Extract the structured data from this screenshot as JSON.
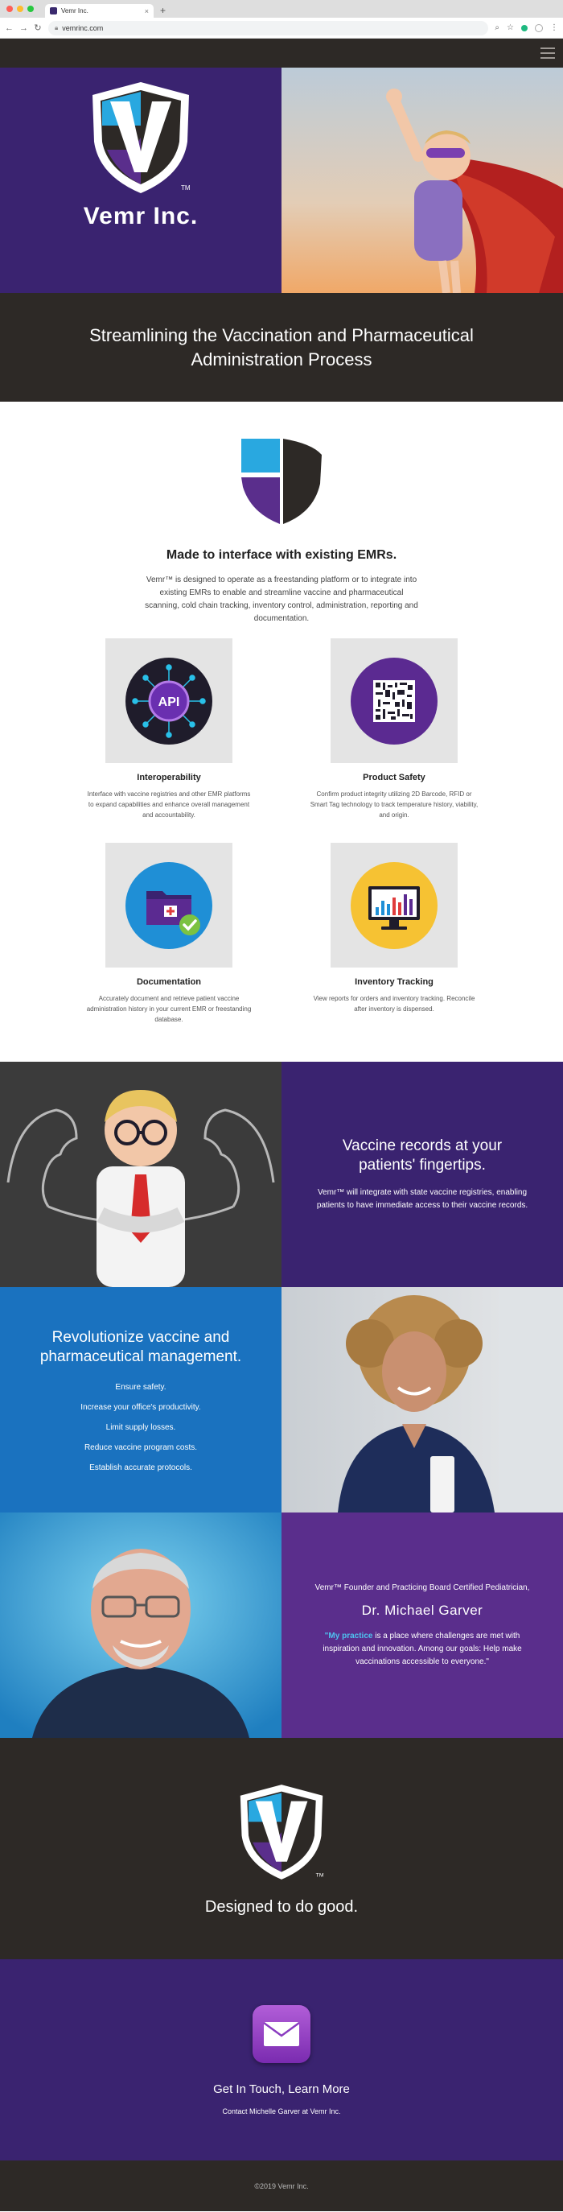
{
  "browser": {
    "tab_title": "Vemr Inc.",
    "tab_close": "×",
    "new_tab": "+",
    "url": "vemrinc.com",
    "nav": {
      "back": "←",
      "forward": "→",
      "reload": "↻"
    },
    "actions": {
      "search": "⌕",
      "star": "☆",
      "menu": "⋮"
    }
  },
  "hero": {
    "brand": "Vemr Inc.",
    "trademark": "TM"
  },
  "banner": {
    "title": "Streamlining the Vaccination and Pharmaceutical Administration Process"
  },
  "emr": {
    "heading": "Made to interface with existing EMRs.",
    "lead": "Vemr™ is designed to operate as a freestanding platform or to integrate into existing EMRs to enable and streamline vaccine and pharmaceutical scanning, cold chain tracking, inventory control, administration, reporting and documentation.",
    "api_label": "API",
    "features": [
      {
        "title": "Interoperability",
        "text": "Interface with vaccine registries and other EMR platforms to expand capabilities and enhance overall management and accountability."
      },
      {
        "title": "Product Safety",
        "text": "Confirm product integrity utilizing 2D Barcode, RFID or Smart Tag technology to track temperature history, viability, and origin."
      },
      {
        "title": "Documentation",
        "text": "Accurately document and retrieve patient vaccine administration history in your current EMR or freestanding database."
      },
      {
        "title": "Inventory Tracking",
        "text": "View reports for orders and inventory tracking. Reconcile after inventory is dispensed."
      }
    ]
  },
  "records": {
    "heading": "Vaccine records at your patients' fingertips.",
    "text": "Vemr™ will integrate with state vaccine registries, enabling patients to have immediate access to their vaccine records."
  },
  "revolutionize": {
    "heading": "Revolutionize vaccine and pharmaceutical management.",
    "items": [
      "Ensure safety.",
      "Increase your office's productivity.",
      "Limit supply losses.",
      "Reduce vaccine program costs.",
      "Establish accurate protocols."
    ]
  },
  "founder": {
    "intro": "Vemr™ Founder and Practicing Board Certified Pediatrician,",
    "name": "Dr. Michael Garver",
    "link": "\"My practice",
    "quote": " is a place where challenges are met with inspiration and innovation. Among our goals: Help make vaccinations accessible to everyone.\""
  },
  "designed": {
    "heading": "Designed to do good.",
    "trademark": "TM"
  },
  "contact": {
    "heading": "Get In Touch, Learn More",
    "text": "Contact Michelle Garver at Vemr Inc."
  },
  "footer": {
    "copyright": "©2019 Vemr Inc."
  },
  "colors": {
    "purple": "#3a2370",
    "dark": "#2d2926",
    "blue": "#1a72bf",
    "violet": "#5a2e8c",
    "accent_cyan": "#29a8e0"
  }
}
